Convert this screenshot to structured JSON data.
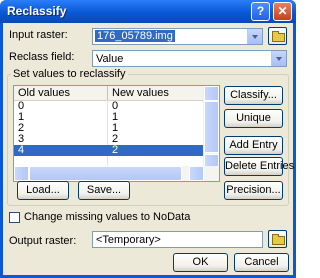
{
  "window": {
    "title": "Reclassify",
    "help_glyph": "?",
    "close_glyph": "✕"
  },
  "input_raster": {
    "label": "Input raster:",
    "value": "176_05789.img"
  },
  "reclass_field": {
    "label": "Reclass field:",
    "value": "Value"
  },
  "group": {
    "title": "Set values to reclassify"
  },
  "table": {
    "columns": [
      "Old values",
      "New values"
    ],
    "rows": [
      {
        "old": "0",
        "new": "0"
      },
      {
        "old": "1",
        "new": "1"
      },
      {
        "old": "2",
        "new": "1"
      },
      {
        "old": "3",
        "new": "2"
      },
      {
        "old": "4",
        "new": "2"
      }
    ],
    "selected_row": 4
  },
  "buttons": {
    "classify": "Classify...",
    "unique": "Unique",
    "add_entry": "Add Entry",
    "delete_entries": "Delete Entries",
    "load": "Load...",
    "save": "Save...",
    "precision": "Precision...",
    "ok": "OK",
    "cancel": "Cancel"
  },
  "nodata_checkbox": {
    "label": "Change missing values to NoData",
    "checked": false
  },
  "output_raster": {
    "label": "Output raster:",
    "value": "<Temporary>"
  },
  "colors": {
    "titlebar": "#0a58d8",
    "selection": "#316ac5",
    "dialog_bg": "#ece9d8"
  }
}
